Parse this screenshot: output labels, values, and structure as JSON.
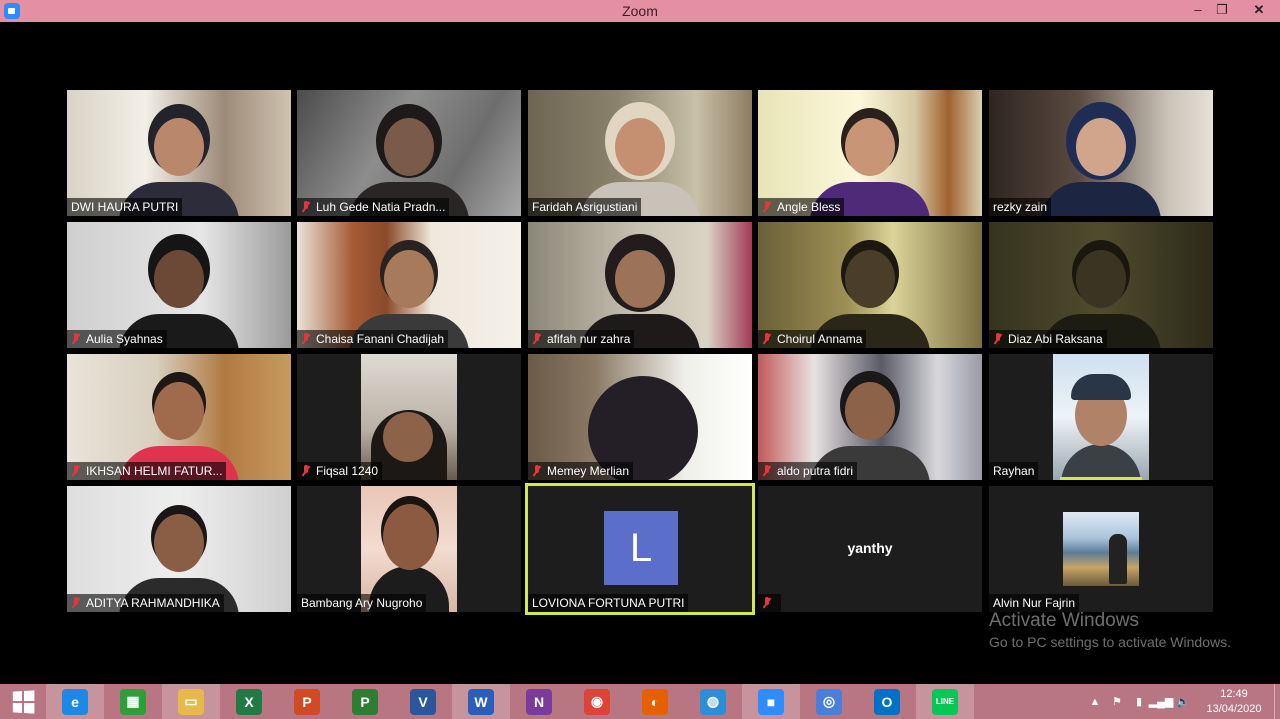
{
  "window": {
    "title": "Zoom",
    "minimize": "–",
    "maximize": "❐",
    "close": "✕"
  },
  "participants": [
    {
      "name": "DWI HAURA PUTRI",
      "muted": false
    },
    {
      "name": "Luh Gede Natia Pradn...",
      "muted": true
    },
    {
      "name": "Faridah Asrigustiani",
      "muted": false
    },
    {
      "name": "Angle Bless",
      "muted": true
    },
    {
      "name": "rezky zain",
      "muted": false
    },
    {
      "name": "Aulia Syahnas",
      "muted": true
    },
    {
      "name": "Chaisa Fanani Chadijah",
      "muted": true
    },
    {
      "name": "afifah nur zahra",
      "muted": true
    },
    {
      "name": "Choirul Annama",
      "muted": true
    },
    {
      "name": "Diaz Abi Raksana",
      "muted": true
    },
    {
      "name": "IKHSAN HELMI FATUR...",
      "muted": true
    },
    {
      "name": "Fiqsal 1240",
      "muted": true
    },
    {
      "name": "Memey Merlian",
      "muted": true
    },
    {
      "name": "aldo putra fidri",
      "muted": true
    },
    {
      "name": "Rayhan",
      "muted": false
    },
    {
      "name": "ADITYA RAHMANDHIKA",
      "muted": true
    },
    {
      "name": "Bambang Ary Nugroho",
      "muted": false
    },
    {
      "name": "LOVIONA FORTUNA PUTRI",
      "muted": false,
      "avatar_letter": "L"
    },
    {
      "name": "yanthy",
      "muted": true
    },
    {
      "name": "Alvin Nur Fajrin",
      "muted": false
    }
  ],
  "watermark": {
    "title": "Activate Windows",
    "subtitle": "Go to PC settings to activate Windows."
  },
  "taskbar": {
    "apps": [
      {
        "icon": "internet-explorer-icon",
        "glyph": "e",
        "color": "#1e88e5",
        "active": true
      },
      {
        "icon": "store-icon",
        "glyph": "▦",
        "color": "#2e9e3a",
        "active": false
      },
      {
        "icon": "file-explorer-icon",
        "glyph": "▭",
        "color": "#e7b94a",
        "active": true
      },
      {
        "icon": "excel-icon",
        "glyph": "X",
        "color": "#1f7a44",
        "active": false
      },
      {
        "icon": "powerpoint-icon",
        "glyph": "P",
        "color": "#d04a26",
        "active": false
      },
      {
        "icon": "project-icon",
        "glyph": "P",
        "color": "#2e7d32",
        "active": false
      },
      {
        "icon": "visio-icon",
        "glyph": "V",
        "color": "#2b579a",
        "active": false
      },
      {
        "icon": "word-icon",
        "glyph": "W",
        "color": "#2b5eb8",
        "active": true
      },
      {
        "icon": "onenote-icon",
        "glyph": "N",
        "color": "#7b3b9a",
        "active": false
      },
      {
        "icon": "chrome-icon",
        "glyph": "◉",
        "color": "#db4437",
        "active": false
      },
      {
        "icon": "firefox-icon",
        "glyph": "◐",
        "color": "#e66000",
        "active": false
      },
      {
        "icon": "globe-icon",
        "glyph": "◍",
        "color": "#2a8fd6",
        "active": false
      },
      {
        "icon": "zoom-icon",
        "glyph": "■",
        "color": "#2d8cff",
        "active": true
      },
      {
        "icon": "chromium-icon",
        "glyph": "◎",
        "color": "#4a7fd9",
        "active": false
      },
      {
        "icon": "outlook-icon",
        "glyph": "O",
        "color": "#0072c6",
        "active": false
      },
      {
        "icon": "line-icon",
        "glyph": "LINE",
        "color": "#06c755",
        "active": true
      }
    ],
    "tray": {
      "chevron": "▲",
      "flag": "⚑",
      "network": "▮",
      "signal": "▂▄▆",
      "volume": "🔈"
    },
    "time": "12:49",
    "date": "13/04/2020"
  },
  "colors": {
    "titlebar": "#e58fa3",
    "taskbar": "#b87582",
    "active_speaker_border": "#d4e84a",
    "muted_mic": "#e8353a",
    "avatar_bg": "#5b6ec9"
  }
}
